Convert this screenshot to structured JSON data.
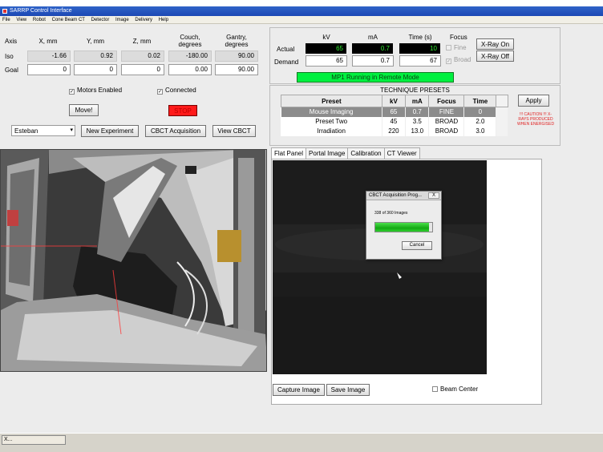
{
  "window": {
    "title": "SARRP Control Interface"
  },
  "menu": [
    "File",
    "View",
    "Robot",
    "Cone Beam CT",
    "Detector",
    "Image",
    "Delivery",
    "Help"
  ],
  "axes": {
    "headers": {
      "axis": "Axis",
      "x": "X, mm",
      "y": "Y, mm",
      "z": "Z, mm",
      "couch": "Couch, degrees",
      "gantry": "Gantry, degrees"
    },
    "iso": {
      "label": "Iso",
      "x": "-1.66",
      "y": "0.92",
      "z": "0.02",
      "couch": "-180.00",
      "gantry": "90.00"
    },
    "goal": {
      "label": "Goal",
      "x": "0",
      "y": "0",
      "z": "0",
      "couch": "0.00",
      "gantry": "90.00"
    }
  },
  "checks": {
    "motors_enabled": "Motors Enabled",
    "connected": "Connected"
  },
  "buttons": {
    "move": "Move!",
    "stop": "STOP",
    "new_experiment": "New Experiment",
    "cbct_acquisition": "CBCT Acquisition",
    "view_cbct": "View CBCT",
    "xray_on": "X-Ray On",
    "xray_off": "X-Ray Off",
    "apply": "Apply",
    "capture_image": "Capture Image",
    "save_image": "Save Image",
    "cancel": "Cancel"
  },
  "user_select": {
    "value": "Esteban"
  },
  "xray": {
    "headers": {
      "kv": "kV",
      "ma": "mA",
      "time": "Time (s)",
      "focus": "Focus"
    },
    "actual": {
      "label": "Actual",
      "kv": "65",
      "ma": "0.7",
      "time": "10"
    },
    "demand": {
      "label": "Demand",
      "kv": "65",
      "ma": "0.7",
      "time": "67"
    },
    "focus_fine": "Fine",
    "focus_broad": "Broad",
    "status": "MP1 Running in Remote Mode"
  },
  "presets": {
    "title": "TECHNIQUE PRESETS",
    "columns": [
      "Preset",
      "kV",
      "mA",
      "Focus",
      "Time"
    ],
    "rows": [
      [
        "Mouse Imaging",
        "65",
        "0.7",
        "FINE",
        "0"
      ],
      [
        "Preset Two",
        "45",
        "3.5",
        "BROAD",
        "2.0"
      ],
      [
        "Irradiation",
        "220",
        "13.0",
        "BROAD",
        "3.0"
      ]
    ]
  },
  "caution": "!!! CAUTION !!! X-RAYS PRODUCED WHEN ENERGISED",
  "tabs": [
    "Flat Panel",
    "Portal Image",
    "Calibration",
    "CT Viewer"
  ],
  "beam_center": "Beam Center",
  "dialog": {
    "title": "CBCT Acquisition Prog...",
    "close": "X",
    "message": "338 of 360 Images",
    "progress": 0.94
  },
  "taskbar": {
    "item": "X..."
  },
  "colors": {
    "stop": "#ff1a1a",
    "lcd_text": "#2eea2e",
    "status_bar": "#00f040",
    "progress": "#13a813"
  }
}
